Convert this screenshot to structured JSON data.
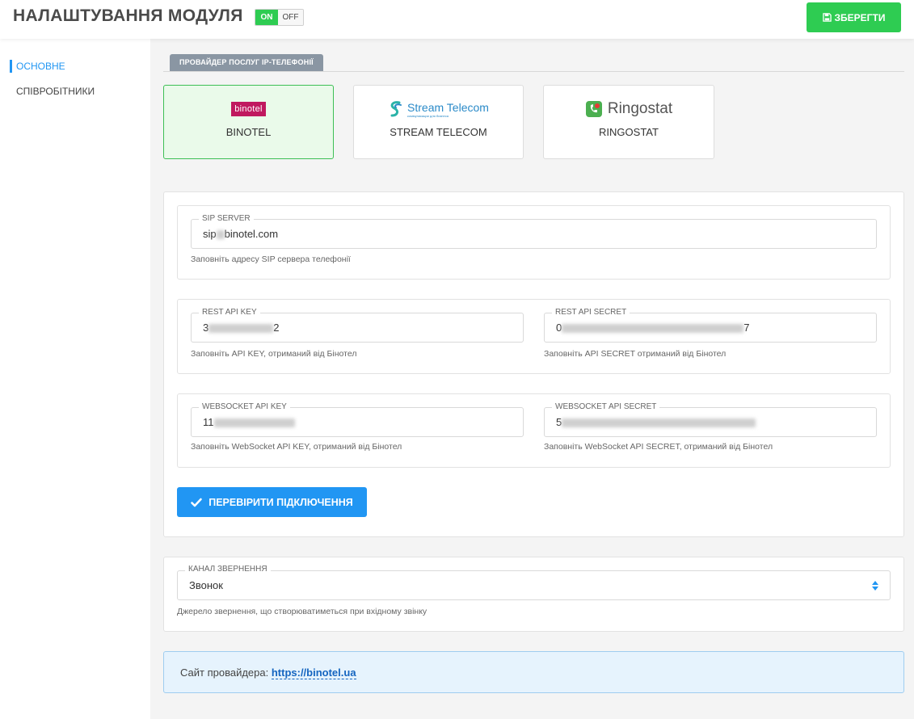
{
  "header": {
    "title": "НАЛАШТУВАННЯ МОДУЛЯ",
    "toggle_on": "ON",
    "toggle_off": "OFF",
    "save_label": "ЗБЕРЕГТИ"
  },
  "sidebar": {
    "items": [
      {
        "label": "ОСНОВНЕ",
        "active": true
      },
      {
        "label": "СПІВРОБІТНИКИ",
        "active": false
      }
    ]
  },
  "provider_tab": "ПРОВАЙДЕР ПОСЛУГ IP-ТЕЛЕФОНІЇ",
  "providers": [
    {
      "name": "BINOTEL",
      "logo_text": "binotel",
      "selected": true
    },
    {
      "name": "STREAM TELECOM",
      "logo_text": "Stream Telecom",
      "logo_subtext": "коммуникации для бизнеса",
      "selected": false
    },
    {
      "name": "RINGOSTAT",
      "logo_text": "Ringostat",
      "selected": false
    }
  ],
  "sip": {
    "label": "SIP SERVER",
    "value_prefix": "sip",
    "value_suffix": "binotel.com",
    "hint": "Заповніть адресу SIP сервера телефонії"
  },
  "rest": {
    "key_label": "REST API KEY",
    "key_visible_start": "3",
    "key_visible_end": "2",
    "key_hint": "Заповніть API KEY, отриманий від Бінотел",
    "secret_label": "REST API SECRET",
    "secret_visible_start": "0",
    "secret_visible_end": "7",
    "secret_hint": "Заповніть API SECRET отриманий від Бінотел"
  },
  "websocket": {
    "key_label": "WEBSOCKET API KEY",
    "key_visible_start": "11",
    "key_hint": "Заповніть WebSocket API KEY, отриманий від Бінотел",
    "secret_label": "WEBSOCKET API SECRET",
    "secret_visible_start": "5",
    "secret_hint": "Заповніть WebSocket API SECRET, отриманий від Бінотел"
  },
  "check_button": "ПЕРЕВІРИТИ ПІДКЛЮЧЕННЯ",
  "channel": {
    "label": "КАНАЛ ЗВЕРНЕННЯ",
    "value": "Звонок",
    "hint": "Джерело звернення, що створюватиметься при вхідному звінку"
  },
  "info": {
    "prefix": "Сайт провайдера: ",
    "link": "https://binotel.ua"
  },
  "colors": {
    "accent_green": "#2ecc52",
    "accent_blue": "#2196f3",
    "binotel_brand": "#c0185f"
  }
}
